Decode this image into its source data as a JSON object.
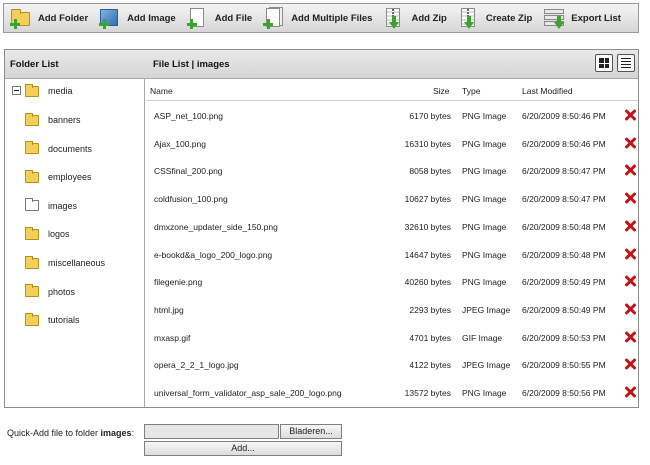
{
  "toolbar": {
    "buttons": [
      {
        "label": "Add Folder",
        "icon": "add-folder-icon"
      },
      {
        "label": "Add Image",
        "icon": "add-image-icon"
      },
      {
        "label": "Add File",
        "icon": "add-file-icon"
      },
      {
        "label": "Add Multiple Files",
        "icon": "add-multiple-files-icon"
      },
      {
        "label": "Add Zip",
        "icon": "add-zip-icon"
      },
      {
        "label": "Create Zip",
        "icon": "create-zip-icon"
      },
      {
        "label": "Export List",
        "icon": "export-list-icon"
      }
    ]
  },
  "folder_panel": {
    "title": "Folder List",
    "root": "media",
    "folders": [
      "banners",
      "documents",
      "employees",
      "images",
      "logos",
      "miscellaneous",
      "photos",
      "tutorials"
    ],
    "selected": "images"
  },
  "file_panel": {
    "title": "File List | images",
    "columns": {
      "name": "Name",
      "size": "Size",
      "type": "Type",
      "modified": "Last Modified"
    },
    "files": [
      {
        "name": "ASP_net_100.png",
        "size": "6170 bytes",
        "type": "PNG Image",
        "modified": "6/20/2009 8:50:46 PM"
      },
      {
        "name": "Ajax_100.png",
        "size": "16310 bytes",
        "type": "PNG Image",
        "modified": "6/20/2009 8:50:46 PM"
      },
      {
        "name": "CSSfinal_200.png",
        "size": "8058 bytes",
        "type": "PNG Image",
        "modified": "6/20/2009 8:50:47 PM"
      },
      {
        "name": "coldfusion_100.png",
        "size": "10627 bytes",
        "type": "PNG Image",
        "modified": "6/20/2009 8:50:47 PM"
      },
      {
        "name": "dmxzone_updater_side_150.png",
        "size": "32610 bytes",
        "type": "PNG Image",
        "modified": "6/20/2009 8:50:48 PM"
      },
      {
        "name": "e-bookd&a_logo_200_logo.png",
        "size": "14647 bytes",
        "type": "PNG Image",
        "modified": "6/20/2009 8:50:48 PM"
      },
      {
        "name": "filegenie.png",
        "size": "40260 bytes",
        "type": "PNG Image",
        "modified": "6/20/2009 8:50:49 PM"
      },
      {
        "name": "html.jpg",
        "size": "2293 bytes",
        "type": "JPEG Image",
        "modified": "6/20/2009 8:50:49 PM"
      },
      {
        "name": "mxasp.gif",
        "size": "4701 bytes",
        "type": "GIF Image",
        "modified": "6/20/2009 8:50:53 PM"
      },
      {
        "name": "opera_2_2_1_logo.jpg",
        "size": "4122 bytes",
        "type": "JPEG Image",
        "modified": "6/20/2009 8:50:55 PM"
      },
      {
        "name": "universal_form_validator_asp_sale_200_logo.png",
        "size": "13572 bytes",
        "type": "PNG Image",
        "modified": "6/20/2009 8:50:56 PM"
      }
    ]
  },
  "quick_add": {
    "label_prefix": "Quick-Add file to folder ",
    "folder": "images",
    "label_suffix": ":",
    "browse_label": "Bladeren...",
    "add_label": "Add..."
  },
  "colors": {
    "delete": "#c0161b",
    "folder": "#f3cf5a",
    "plus": "#3aa52b"
  }
}
